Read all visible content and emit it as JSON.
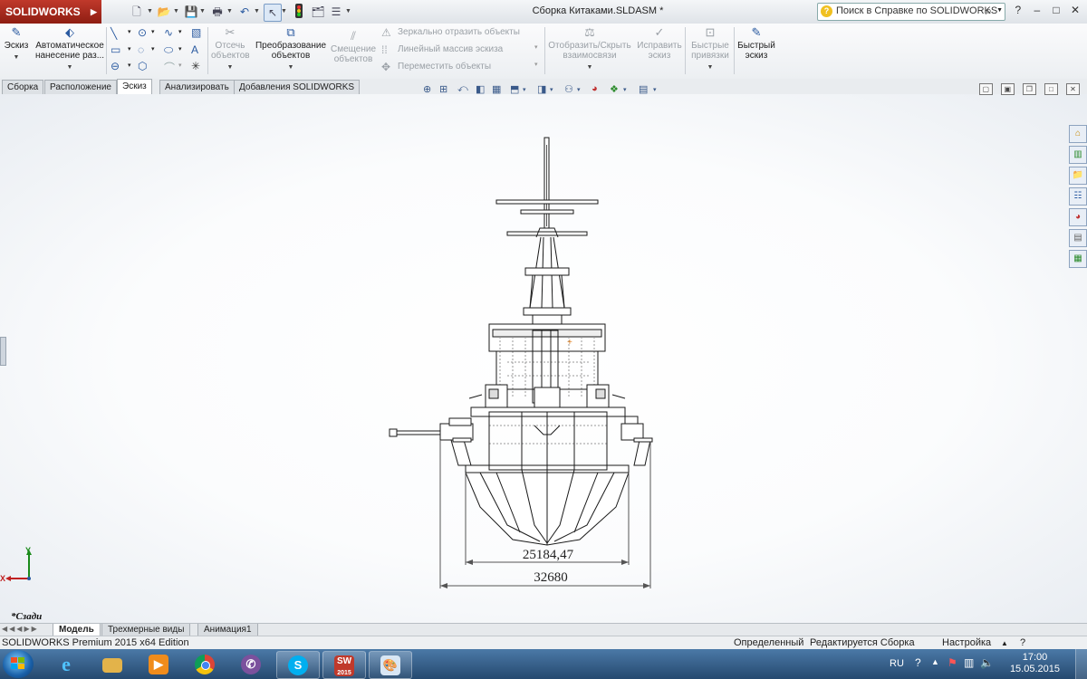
{
  "title_bar": {
    "app_logo": "SOLIDWORKS",
    "window_title": "Сборка Китаками.SLDASM *",
    "help_placeholder": "Поиск в Справке по SOLIDWORKS",
    "window_controls": [
      "?",
      "–",
      "□",
      "✕"
    ]
  },
  "ribbon": {
    "sketch": "Эскиз",
    "smart_dim": "Автоматическое нанесение раз...",
    "trim": "Отсечь объектов",
    "convert": "Преобразование объектов",
    "offset": "Смещение объектов",
    "mirror": "Зеркально отразить объекты",
    "linear_pattern": "Линейный массив эскиза",
    "move": "Переместить объекты",
    "show_relations": "Отобразить/Скрыть взаимосвязи",
    "repair": "Исправить эскиз",
    "quick_snaps": "Быстрые привязки",
    "rapid_sketch": "Быстрый эскиз"
  },
  "command_tabs": [
    {
      "label": "Сборка",
      "active": false
    },
    {
      "label": "Расположение",
      "active": false
    },
    {
      "label": "Эскиз",
      "active": true
    },
    {
      "label": "Анализировать",
      "active": false
    },
    {
      "label": "Добавления SOLIDWORKS",
      "active": false
    }
  ],
  "viewport": {
    "view_orientation": "*Сзади",
    "dimension_1": "25184,47",
    "dimension_2": "32680",
    "axis_y": "Y",
    "axis_x": "X"
  },
  "model_tabs": [
    {
      "label": "Модель",
      "active": true
    },
    {
      "label": "Трехмерные виды",
      "active": false
    },
    {
      "label": "Анимация1",
      "active": false
    }
  ],
  "status_bar": {
    "edition": "SOLIDWORKS Premium 2015 x64 Edition",
    "state": "Определенный",
    "editing": "Редактируется Сборка",
    "settings": "Настройка"
  },
  "taskbar": {
    "language": "RU",
    "time": "17:00",
    "date": "15.05.2015",
    "sw_badge": "2015"
  },
  "colors": {
    "accent_red": "#c0392b",
    "taskbar_blue": "#2f5a86",
    "drawing_line": "#1a1a1a"
  }
}
